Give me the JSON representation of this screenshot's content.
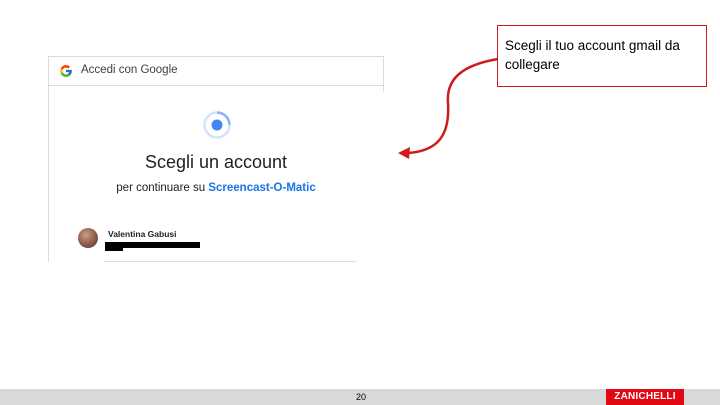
{
  "screenshot": {
    "header_title": "Accedi con Google",
    "title": "Scegli un account",
    "subtitle_prefix": "per continuare su ",
    "subtitle_app": "Screencast-O-Matic",
    "account_name": "Valentina Gabusi"
  },
  "callout": {
    "text": "Scegli il tuo account gmail da collegare",
    "border_color": "#d11a1a"
  },
  "footer": {
    "page_number": "20",
    "brand": "ZANICHELLI",
    "brand_color": "#e30613"
  },
  "icons": [
    "google-g-icon",
    "loading-spinner-icon",
    "avatar",
    "curved-arrow-icon"
  ]
}
